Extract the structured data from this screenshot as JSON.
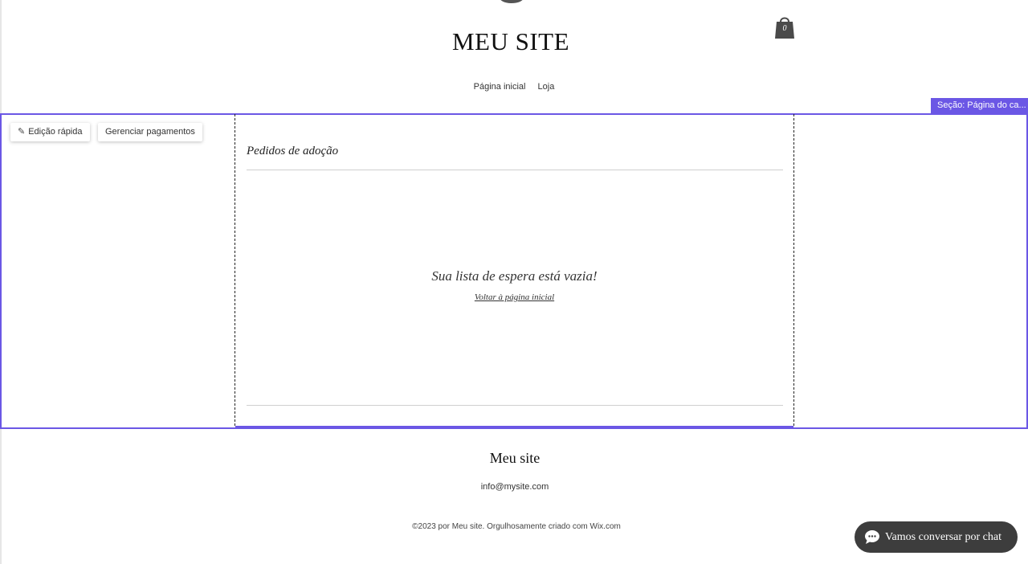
{
  "header": {
    "site_title": "MEU SITE",
    "cart_count": "0",
    "nav": [
      "Página inicial",
      "Loja"
    ]
  },
  "editor": {
    "section_tag": "Seção: Página do ca...",
    "quick_edit_label": "Edição rápida",
    "manage_payments_label": "Gerenciar pagamentos"
  },
  "main": {
    "heading": "Pedidos de adoção",
    "empty_message": "Sua lista de espera está vazia!",
    "back_link": "Voltar à página inicial"
  },
  "footer": {
    "title": "Meu site",
    "email": "info@mysite.com",
    "copyright": "©2023 por Meu site. Orgulhosamente criado com Wix.com"
  },
  "chat": {
    "label": "Vamos conversar por chat"
  },
  "colors": {
    "accent": "#6b57e5",
    "chat_bg": "#3d3d3d"
  }
}
